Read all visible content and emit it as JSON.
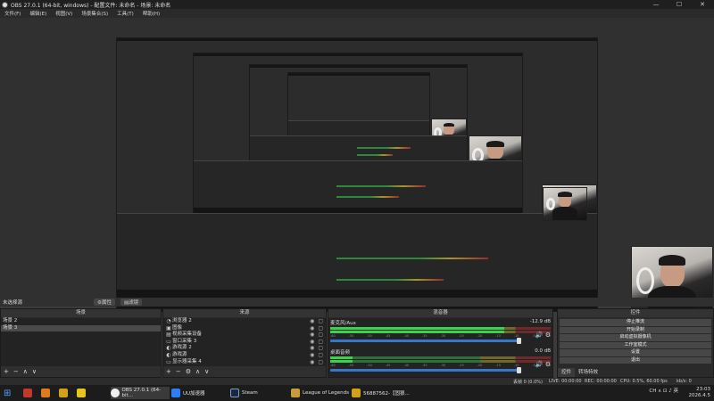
{
  "window": {
    "title": "OBS 27.0.1 (64-bit, windows) - 配置文件: 未命名 - 场景: 未命名",
    "controls": [
      "—",
      "☐",
      "✕"
    ]
  },
  "menu": [
    "文件(F)",
    "编辑(E)",
    "视图(V)",
    "场景集合(S)",
    "工具(T)",
    "帮助(H)"
  ],
  "dock_title": {
    "label": "未选择源",
    "properties": "⚙属性",
    "filters": "▤滤镜"
  },
  "scenes": {
    "header": "场景",
    "items": [
      {
        "label": "场景 2",
        "selected": false
      },
      {
        "label": "场景 3",
        "selected": true
      }
    ],
    "tools": [
      "+",
      "−",
      "∧",
      "∨"
    ]
  },
  "sources": {
    "header": "来源",
    "items": [
      {
        "icon": "◔",
        "label": "浏览器 2"
      },
      {
        "icon": "▣",
        "label": "图像"
      },
      {
        "icon": "▤",
        "label": "视频采集设备"
      },
      {
        "icon": "▭",
        "label": "窗口采集 3"
      },
      {
        "icon": "◐",
        "label": "游戏源 2"
      },
      {
        "icon": "◐",
        "label": "游戏源"
      },
      {
        "icon": "▭",
        "label": "显示器采集 4"
      }
    ],
    "tools": [
      "+",
      "−",
      "⚙",
      "∧",
      "∨"
    ]
  },
  "mixer": {
    "header": "混音器",
    "channels": [
      {
        "name": "麦克风/Aux",
        "db": "-12.9 dB",
        "level": 0.79
      },
      {
        "name": "桌面音频",
        "db": "0.0 dB",
        "level": 0.1
      }
    ],
    "ticks": [
      "-60",
      "-55",
      "-50",
      "-45",
      "-40",
      "-35",
      "-30",
      "-25",
      "-20",
      "-15",
      "-10",
      "-5",
      "0"
    ]
  },
  "controls": {
    "header": "控件",
    "buttons": [
      "停止推流",
      "开始录制",
      "启动虚拟摄像机",
      "工作室模式",
      "设置",
      "退出"
    ],
    "tabs": [
      "控件",
      "转场特效"
    ]
  },
  "status": {
    "dropped": "丢帧 0 (0.0%)",
    "live": "LIVE: 00:00:00",
    "rec": "REC: 00:00:00",
    "cpu": "CPU: 0.5%, 60.00 fps",
    "kbps": "kb/s: 0"
  },
  "taskbar": {
    "items": [
      {
        "label": "",
        "color": "#c0392b"
      },
      {
        "label": "",
        "color": "#e07a1f"
      },
      {
        "label": "",
        "color": "#d4a017"
      },
      {
        "label": "",
        "color": "#e6c619"
      },
      {
        "label": "OBS 27.0.1 (64-bit...",
        "color": "#f0f0f0"
      },
      {
        "label": "UU加速器",
        "color": "#2d7ff9"
      },
      {
        "label": "Steam",
        "color": "#1b2838"
      },
      {
        "label": "League of Legends",
        "color": "#c89b3c"
      },
      {
        "label": "56887562-【固狼...",
        "color": "#d4a017"
      }
    ],
    "time": "23:03",
    "date": "2026.4.5",
    "tray": "CH ∧ ⊡ ♪ 英"
  }
}
